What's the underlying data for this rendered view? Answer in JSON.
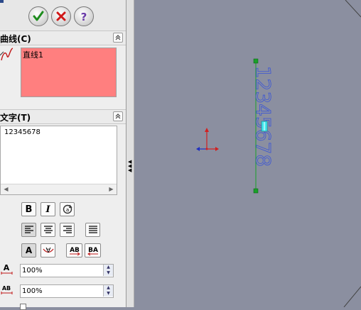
{
  "toolbar": {
    "ok_icon": "check-icon",
    "cancel_icon": "x-icon",
    "help_icon": "question-icon"
  },
  "curve_section": {
    "title": "曲线(C)",
    "selected_item": "直线1",
    "selection_color": "#ff7f7f"
  },
  "text_section": {
    "title": "文字(T)",
    "text_value": "12345678",
    "format_buttons": [
      {
        "name": "bold",
        "label": "B"
      },
      {
        "name": "italic",
        "label": "I"
      },
      {
        "name": "rotate",
        "label": "⟳"
      }
    ],
    "align_buttons": [
      "align-left",
      "align-center",
      "align-right",
      "justify"
    ],
    "char_buttons": [
      {
        "name": "normal-text",
        "label": "A"
      },
      {
        "name": "flip-text",
        "label": "A"
      },
      {
        "name": "ab-normal",
        "label": "AB"
      },
      {
        "name": "ab-flipped",
        "label": "BA"
      }
    ],
    "height_value": "100%",
    "spacing_value": "100%",
    "spacing_icon_label": "AB",
    "height_icon_label": "A"
  },
  "canvas": {
    "sketch_text": "12345678",
    "background": "#8b8fa0",
    "text_color": "#3a55d6",
    "line_color": "#1aa02a"
  }
}
